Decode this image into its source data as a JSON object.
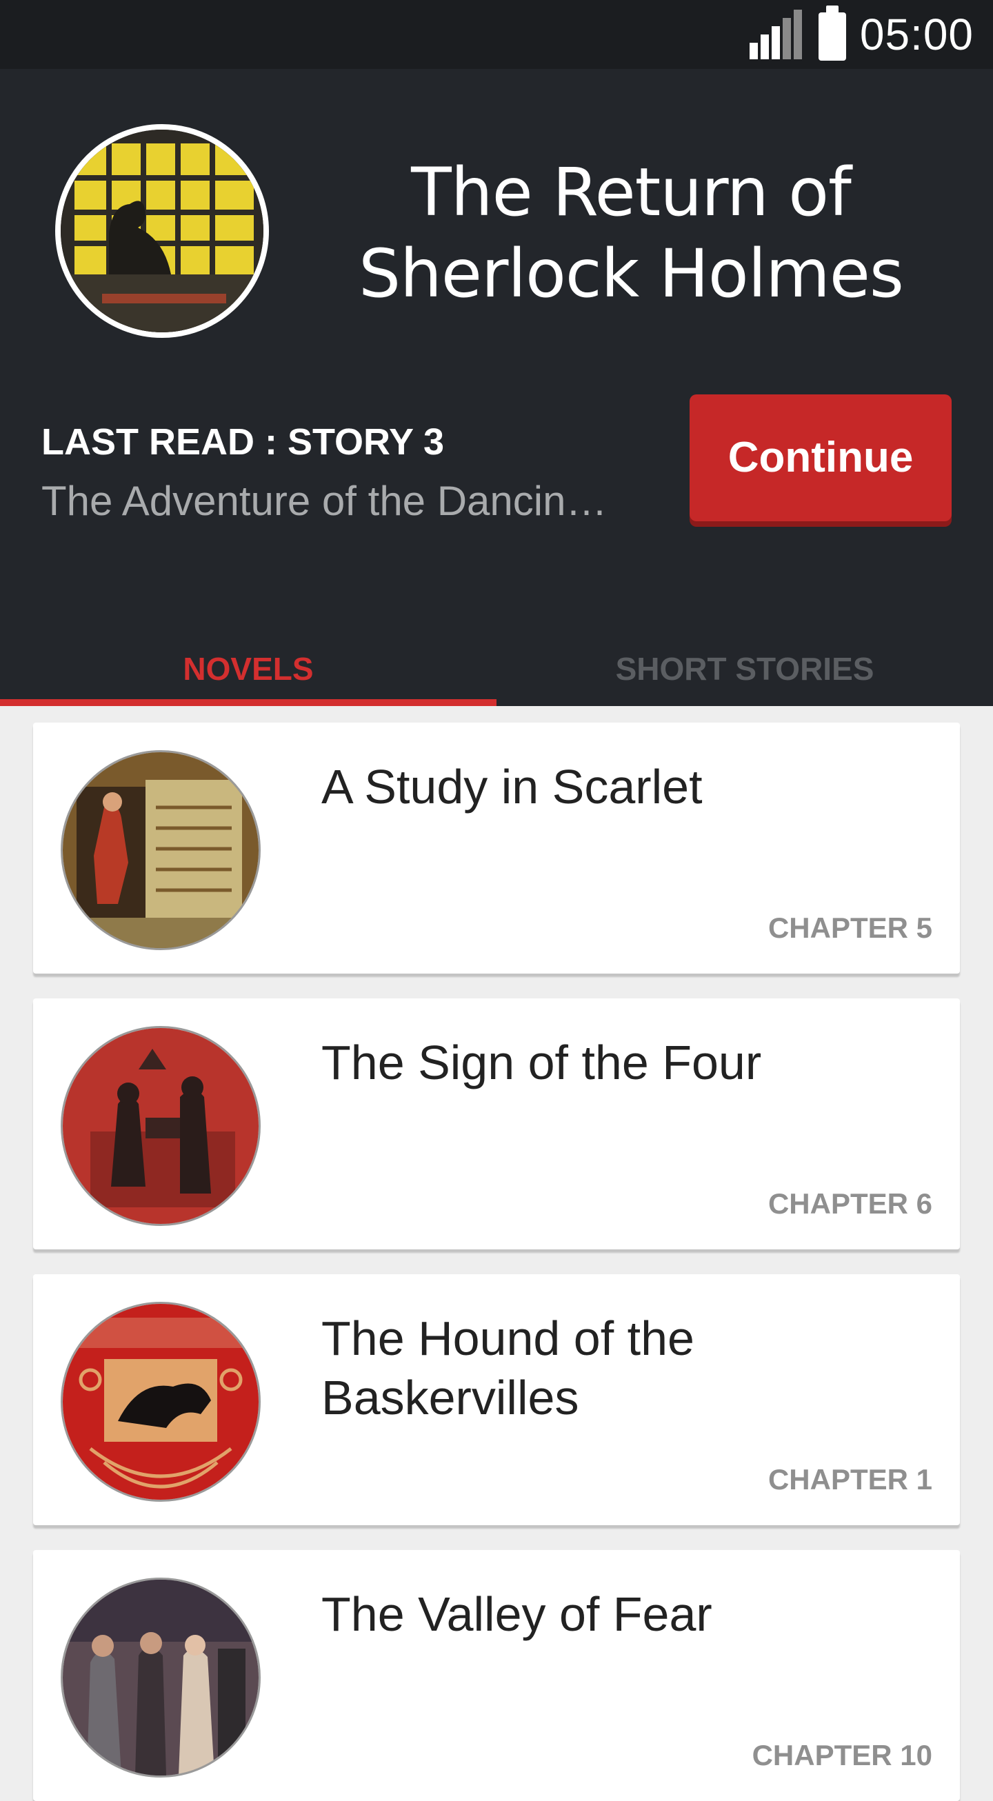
{
  "status_bar": {
    "time": "05:00",
    "icons": [
      "signal-icon",
      "battery-icon"
    ]
  },
  "header": {
    "title": "The Return of Sherlock Holmes",
    "last_read_label": "LAST READ : STORY 3",
    "last_read_story": "The Adventure of the Dancin…",
    "continue_label": "Continue"
  },
  "tabs": [
    {
      "label": "NOVELS",
      "selected": true
    },
    {
      "label": "SHORT STORIES",
      "selected": false
    }
  ],
  "novels": [
    {
      "title": "A Study in Scarlet",
      "chapter": "CHAPTER 5"
    },
    {
      "title": "The Sign of the Four",
      "chapter": "CHAPTER 6"
    },
    {
      "title": "The Hound of the Baskervilles",
      "chapter": "CHAPTER 1"
    },
    {
      "title": "The Valley of Fear",
      "chapter": "CHAPTER 10"
    }
  ],
  "colors": {
    "accent": "#d32f2f",
    "header_bg": "#23262b",
    "statusbar_bg": "#1b1d20"
  }
}
